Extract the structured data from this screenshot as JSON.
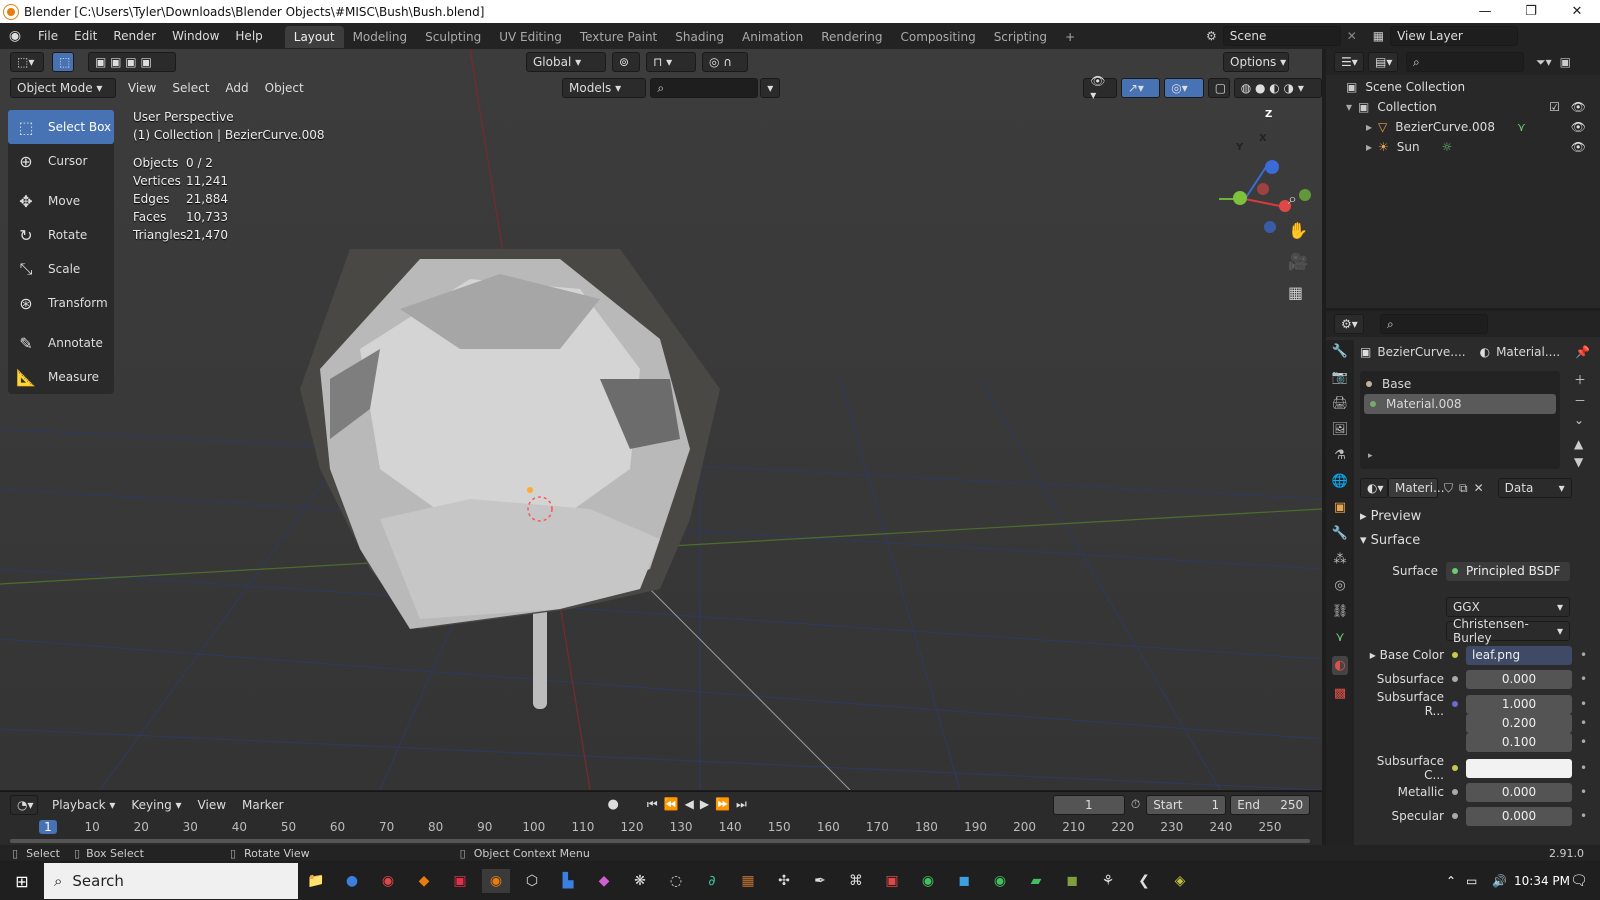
{
  "window": {
    "title": "Blender [C:\\Users\\Tyler\\Downloads\\Blender Objects\\#MISC\\Bush\\Bush.blend]",
    "minimize": "—",
    "maximize": "❐",
    "close": "✕"
  },
  "menu": [
    "File",
    "Edit",
    "Render",
    "Window",
    "Help"
  ],
  "workspaces": {
    "active": "Layout",
    "tabs": [
      "Layout",
      "Modeling",
      "Sculpting",
      "UV Editing",
      "Texture Paint",
      "Shading",
      "Animation",
      "Rendering",
      "Compositing",
      "Scripting"
    ],
    "add": "+"
  },
  "scene": {
    "label": "Scene",
    "view_layer": "View Layer"
  },
  "viewport_header": {
    "transform": "Global",
    "options": "Options",
    "mode": "Object Mode",
    "view": "View",
    "select": "Select",
    "add": "Add",
    "object": "Object",
    "collection": "Models"
  },
  "toolbar": [
    {
      "label": "Select Box",
      "icon": "select-box-icon",
      "glyph": "⬚",
      "active": true
    },
    {
      "label": "Cursor",
      "icon": "cursor-icon",
      "glyph": "⊕",
      "active": false
    },
    {
      "label": "Move",
      "icon": "move-icon",
      "glyph": "✥",
      "active": false
    },
    {
      "label": "Rotate",
      "icon": "rotate-icon",
      "glyph": "↻",
      "active": false
    },
    {
      "label": "Scale",
      "icon": "scale-icon",
      "glyph": "⤡",
      "active": false
    },
    {
      "label": "Transform",
      "icon": "transform-icon",
      "glyph": "⊛",
      "active": false
    },
    {
      "label": "Annotate",
      "icon": "annotate-icon",
      "glyph": "✎",
      "active": false
    },
    {
      "label": "Measure",
      "icon": "measure-icon",
      "glyph": "📐",
      "active": false
    }
  ],
  "overlay": {
    "perspective": "User Perspective",
    "context": "(1) Collection | BezierCurve.008",
    "stats": [
      {
        "label": "Objects",
        "value": "0 / 2"
      },
      {
        "label": "Vertices",
        "value": "11,241"
      },
      {
        "label": "Edges",
        "value": "21,884"
      },
      {
        "label": "Faces",
        "value": "10,733"
      },
      {
        "label": "Triangles",
        "value": "21,470"
      }
    ]
  },
  "gizmo": {
    "x": "X",
    "y": "Y",
    "z": "Z"
  },
  "timeline": {
    "playback": "Playback",
    "keying": "Keying",
    "view": "View",
    "marker": "Marker",
    "current_frame": "1",
    "start_label": "Start",
    "start": "1",
    "end_label": "End",
    "end": "250",
    "ticks": [
      "1",
      "10",
      "20",
      "30",
      "40",
      "50",
      "60",
      "70",
      "80",
      "90",
      "100",
      "110",
      "120",
      "130",
      "140",
      "150",
      "160",
      "170",
      "180",
      "190",
      "200",
      "210",
      "220",
      "230",
      "240",
      "250"
    ]
  },
  "statusbar": {
    "select": "Select",
    "box_select": "Box Select",
    "rotate_view": "Rotate View",
    "context_menu": "Object Context Menu",
    "version": "2.91.0"
  },
  "outliner": {
    "root": "Scene Collection",
    "collection": "Collection",
    "items": [
      "BezierCurve.008",
      "Sun"
    ]
  },
  "properties": {
    "object_name": "BezierCurve....",
    "material_name": "Material....",
    "slots": [
      "Base",
      "Material.008"
    ],
    "material_field": "Materi...",
    "link": "Data",
    "preview": "Preview",
    "surface_section": "Surface",
    "surface_label": "Surface",
    "surface_value": "Principled BSDF",
    "distribution": "GGX",
    "subsurface_method": "Christensen-Burley",
    "rows": [
      {
        "label": "Base Color",
        "value": "leaf.png"
      },
      {
        "label": "Subsurface",
        "value": "0.000"
      },
      {
        "label": "Subsurface R...",
        "value": "1.000"
      },
      {
        "label": "",
        "value": "0.200"
      },
      {
        "label": "",
        "value": "0.100"
      },
      {
        "label": "Subsurface C...",
        "value": ""
      },
      {
        "label": "Metallic",
        "value": "0.000"
      },
      {
        "label": "Specular",
        "value": "0.000"
      }
    ]
  },
  "taskbar": {
    "search": "Search",
    "time": "10:34 PM"
  }
}
